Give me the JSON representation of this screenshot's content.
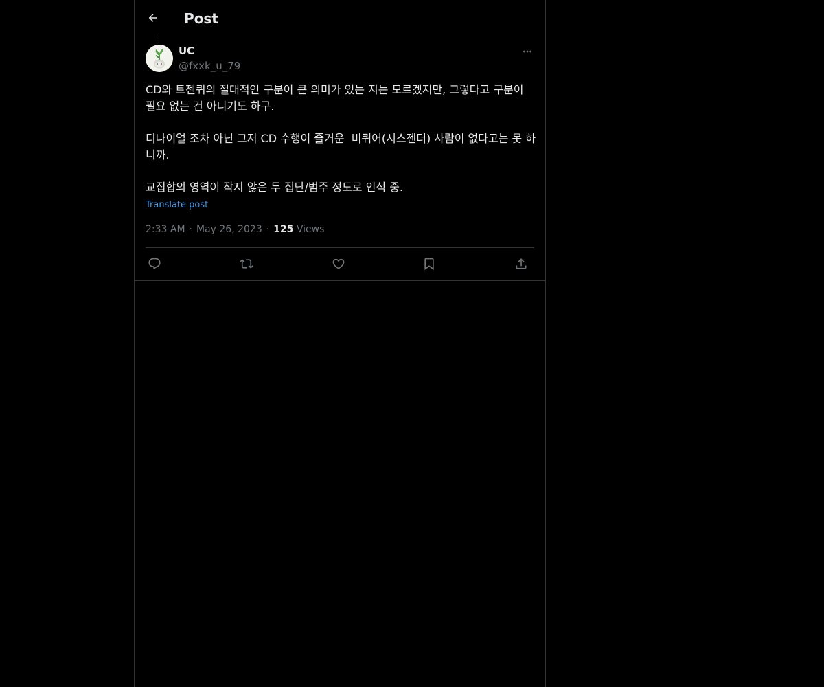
{
  "colors": {
    "background": "#000000",
    "border": "#2f3336",
    "text_primary": "#e7e9ea",
    "text_secondary": "#71767b",
    "link": "#4a99e9"
  },
  "header": {
    "back_icon": "arrow-left-icon",
    "title": "Post"
  },
  "post": {
    "author": {
      "name": "UC",
      "handle": "@fxxk_u_79",
      "avatar_icon": "plant-avatar"
    },
    "more_icon": "more-horizontal-icon",
    "paragraphs": [
      "CD와 트젠퀴의 절대적인 구분이 큰 의미가 있는 지는 모르겠지만, 그렇다고 구분이 필요 없는 건 아니기도 하구.",
      "디나이얼 조차 아닌 그저 CD 수행이 즐거운  비퀴어(시스젠더) 사람이 없다고는 못 하니까.",
      "교집합의 영역이 작지 않은 두 집단/범주 정도로 인식 중."
    ],
    "translate_label": "Translate post",
    "time": "2:33 AM",
    "date": "May 26, 2023",
    "separator": "·",
    "views_count": "125",
    "views_label": "Views"
  },
  "actions": [
    {
      "name": "reply",
      "icon": "reply-icon"
    },
    {
      "name": "repost",
      "icon": "repost-icon"
    },
    {
      "name": "like",
      "icon": "heart-icon"
    },
    {
      "name": "bookmark",
      "icon": "bookmark-icon"
    },
    {
      "name": "share",
      "icon": "share-icon"
    }
  ]
}
